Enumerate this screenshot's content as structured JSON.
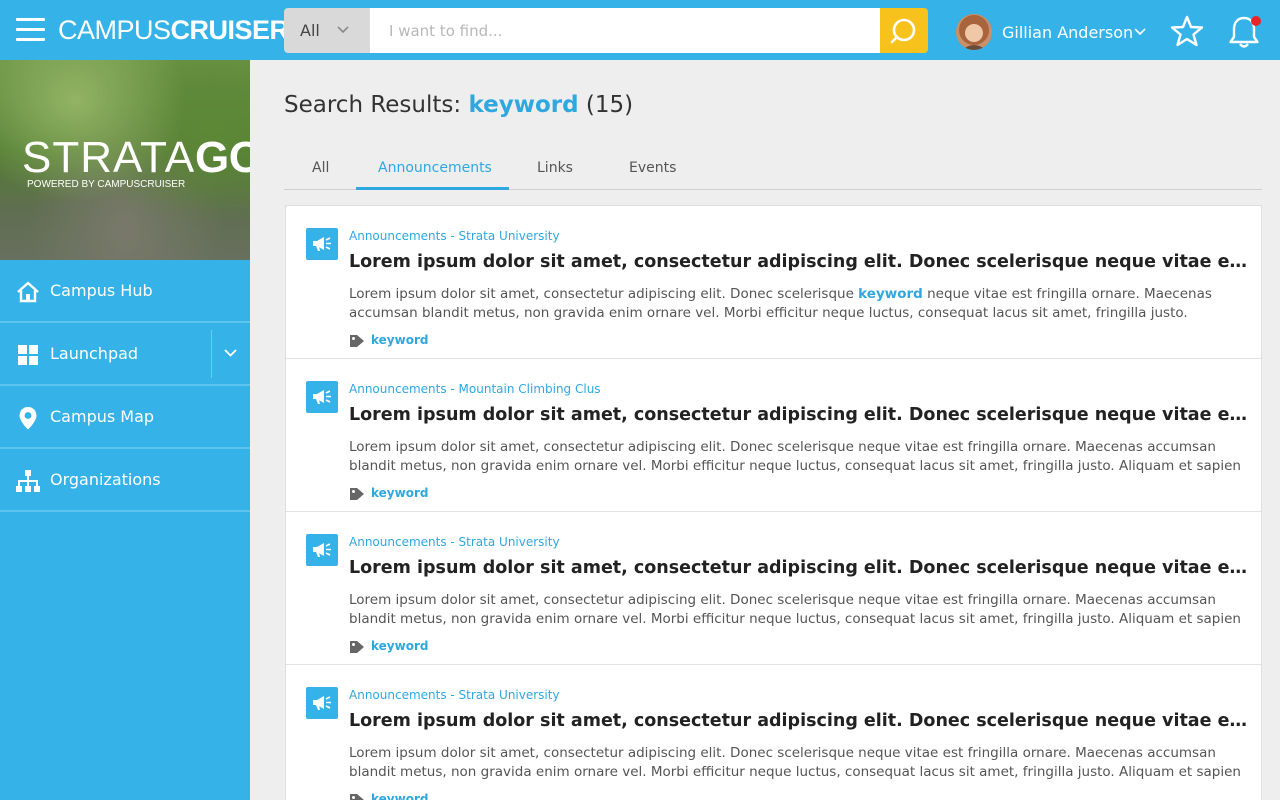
{
  "brand": {
    "part1": "CAMPUS",
    "part2": "CRUISER"
  },
  "search": {
    "scope": "All",
    "placeholder": "I want to find..."
  },
  "user": {
    "name": "Gillian Anderson"
  },
  "sidebar": {
    "logo_part1": "STRATA",
    "logo_part2": "GO",
    "logo_sub": "POWERED BY CAMPUSCRUISER",
    "items": [
      {
        "label": "Campus Hub",
        "icon": "home-icon"
      },
      {
        "label": "Launchpad",
        "icon": "grid-icon"
      },
      {
        "label": "Campus Map",
        "icon": "map-pin-icon"
      },
      {
        "label": "Organizations",
        "icon": "org-chart-icon"
      }
    ]
  },
  "results": {
    "prefix": "Search Results: ",
    "keyword": "keyword",
    "count": "(15)"
  },
  "tabs": [
    {
      "label": "All"
    },
    {
      "label": "Announcements",
      "active": true
    },
    {
      "label": "Links"
    },
    {
      "label": "Events"
    }
  ],
  "cards": [
    {
      "source": "Announcements - Strata University",
      "title": "Lorem ipsum dolor sit amet, consectetur adipiscing elit. Donec scelerisque neque vitae est...",
      "body_before": "Lorem ipsum dolor sit amet, consectetur adipiscing elit. Donec scelerisque ",
      "body_highlight": "keyword",
      "body_after": " neque vitae est fringilla ornare. Maecenas accumsan blandit metus, non gravida enim ornare vel. Morbi efficitur neque luctus, consequat lacus sit amet, fringilla justo. Aliquam et",
      "tag": "keyword"
    },
    {
      "source": "Announcements - Mountain Climbing Clus",
      "title": "Lorem ipsum dolor sit amet, consectetur adipiscing elit. Donec scelerisque neque vitae est...",
      "body": "Lorem ipsum dolor sit amet, consectetur adipiscing elit. Donec scelerisque neque vitae est fringilla ornare. Maecenas accumsan blandit metus, non gravida enim ornare vel. Morbi efficitur neque luctus, consequat lacus sit amet, fringilla justo. Aliquam et sapien vitae odio",
      "tag": "keyword"
    },
    {
      "source": "Announcements - Strata University",
      "title": "Lorem ipsum dolor sit amet, consectetur adipiscing elit. Donec scelerisque neque vitae est...",
      "body": "Lorem ipsum dolor sit amet, consectetur adipiscing elit. Donec scelerisque neque vitae est fringilla ornare. Maecenas accumsan blandit metus, non gravida enim ornare vel. Morbi efficitur neque luctus, consequat lacus sit amet, fringilla justo. Aliquam et sapien vitae odio",
      "tag": "keyword"
    },
    {
      "source": "Announcements - Strata University",
      "title": "Lorem ipsum dolor sit amet, consectetur adipiscing elit. Donec scelerisque neque vitae est...",
      "body": "Lorem ipsum dolor sit amet, consectetur adipiscing elit. Donec scelerisque neque vitae est fringilla ornare. Maecenas accumsan blandit metus, non gravida enim ornare vel. Morbi efficitur neque luctus, consequat lacus sit amet, fringilla justo. Aliquam et sapien vitae odio",
      "tag": "keyword"
    }
  ],
  "colors": {
    "primary": "#35b3e8",
    "accent_link": "#2fa8df",
    "search_button": "#f8c21c",
    "notification_dot": "#e8262a",
    "page_bg": "#eeeeee"
  }
}
